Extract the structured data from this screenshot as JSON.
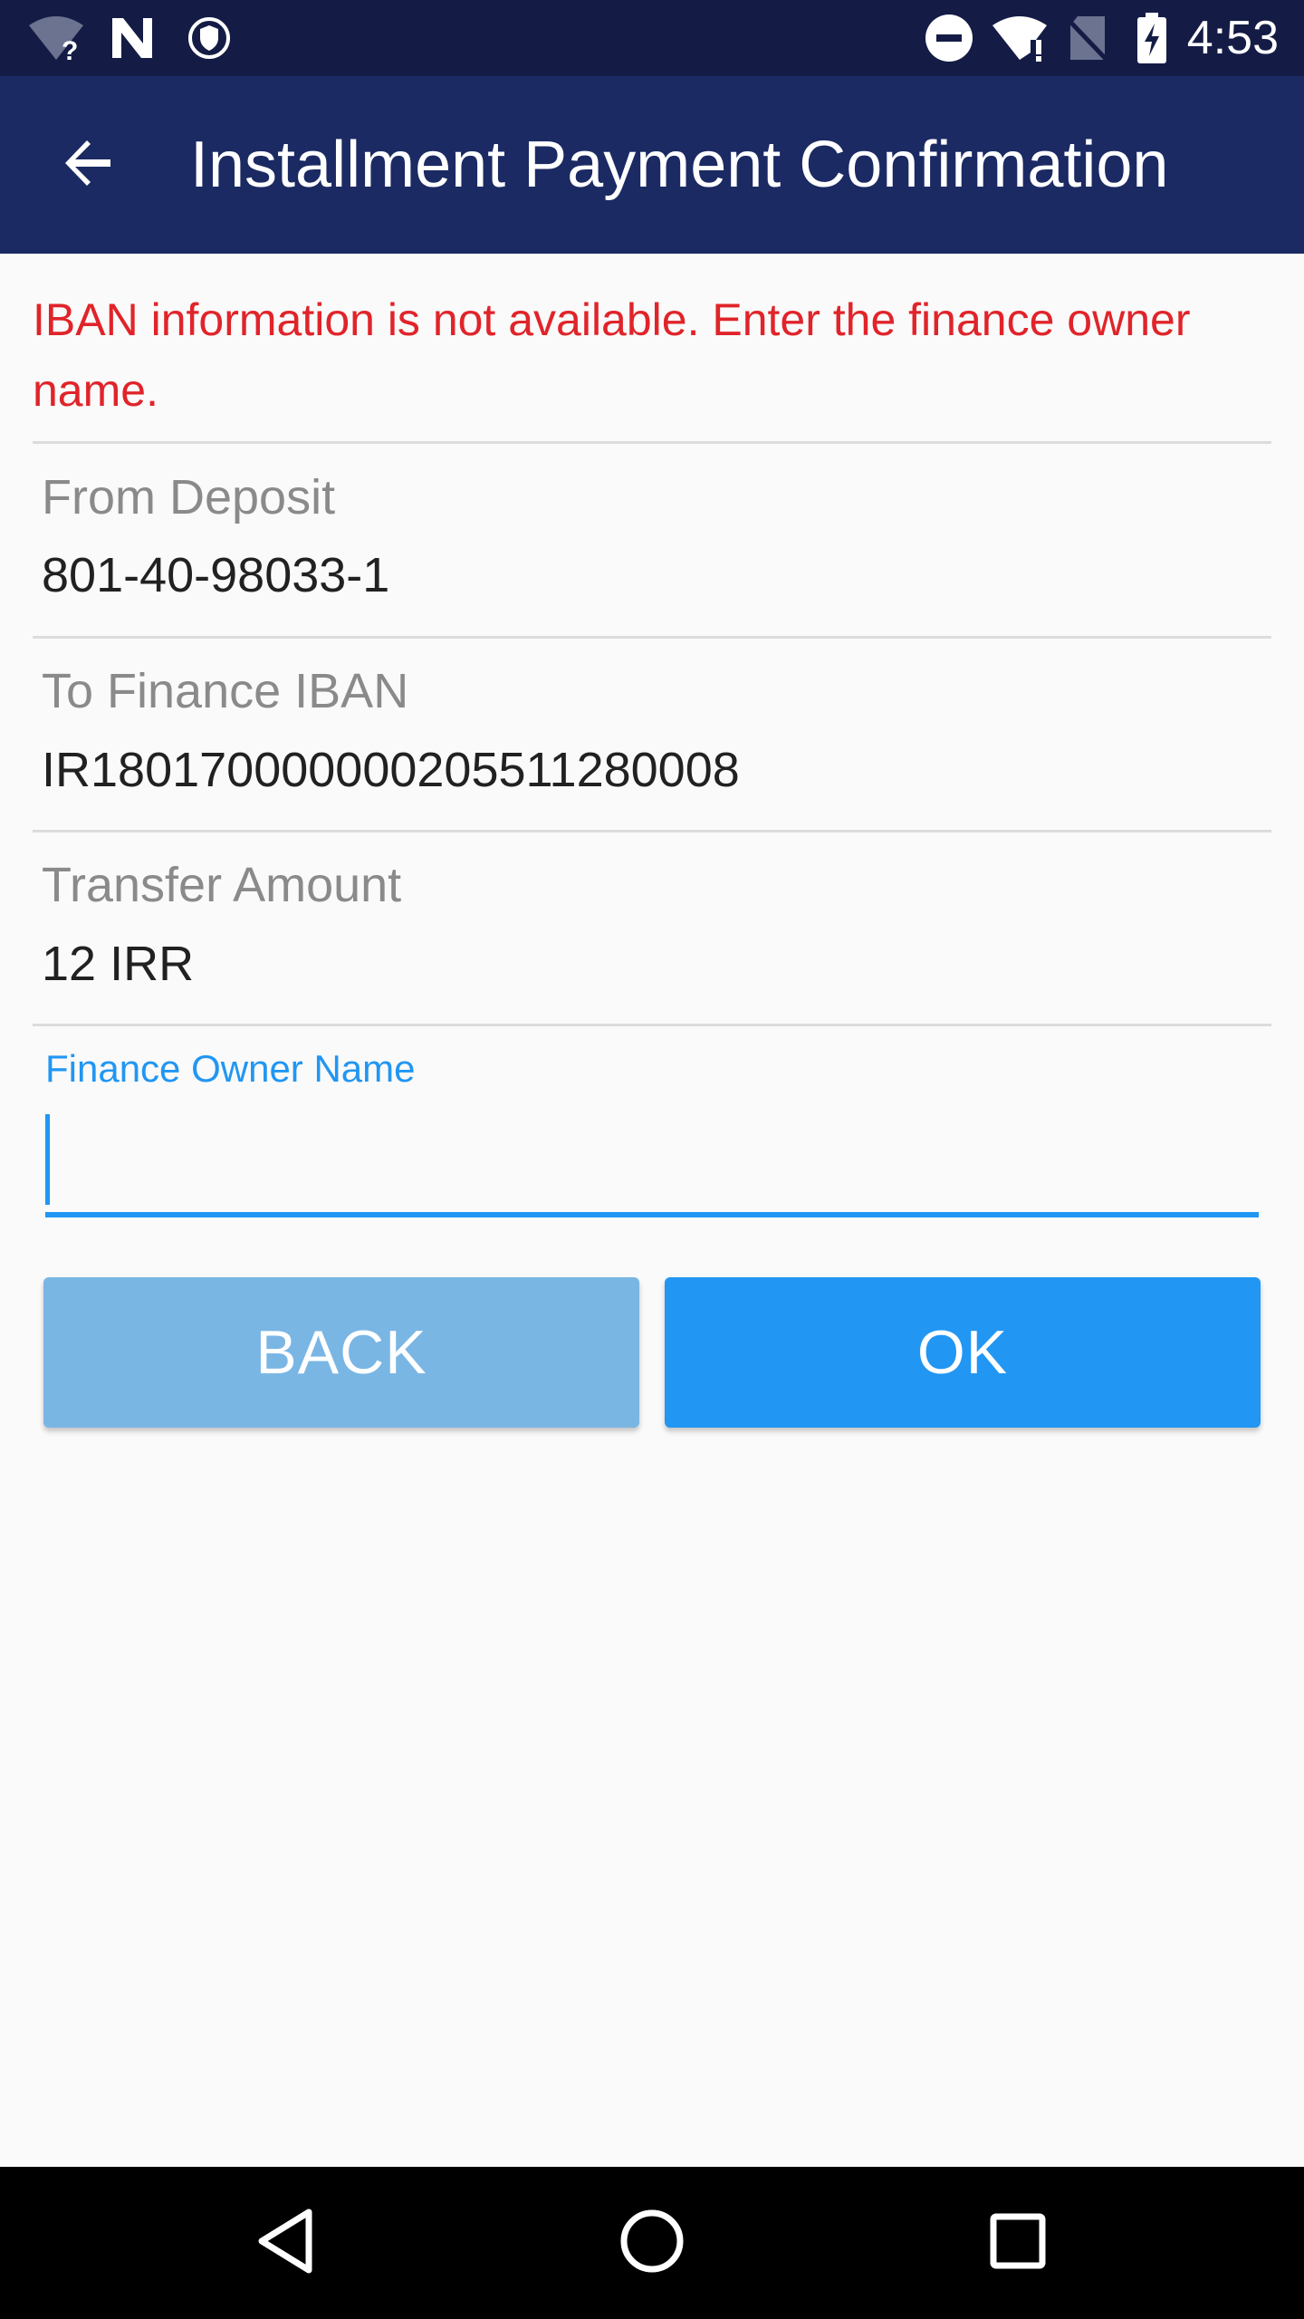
{
  "status_bar": {
    "time": "4:53",
    "icons": [
      "wifi-unknown-icon",
      "n-notification-icon",
      "vpn-shield-icon",
      "do-not-disturb-icon",
      "wifi-alert-icon",
      "no-sim-icon",
      "battery-charging-icon"
    ]
  },
  "app_bar": {
    "title": "Installment Payment Confirmation",
    "back_icon": "arrow-back-icon"
  },
  "error_message": "IBAN information is not available. Enter the finance owner name.",
  "details": [
    {
      "label": "From Deposit",
      "value": "801-40-98033-1"
    },
    {
      "label": "To Finance IBAN",
      "value": "IR180170000000205511280008"
    },
    {
      "label": "Transfer Amount",
      "value": "12 IRR"
    }
  ],
  "owner_field": {
    "label": "Finance Owner Name",
    "value": ""
  },
  "buttons": {
    "back_label": "BACK",
    "ok_label": "OK"
  },
  "nav_bar": {
    "icons": [
      "nav-back-icon",
      "nav-home-icon",
      "nav-recents-icon"
    ]
  },
  "colors": {
    "status_bar": "#141c46",
    "app_bar": "#1b2a63",
    "error_text": "#e0242a",
    "accent": "#2196f3",
    "back_button": "#7ab6e4"
  }
}
